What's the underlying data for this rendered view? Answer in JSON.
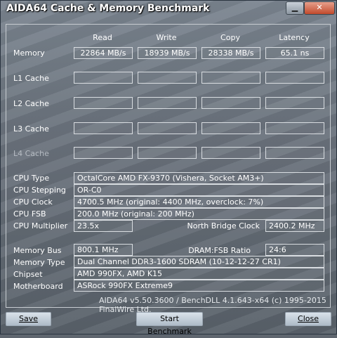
{
  "window": {
    "title": "AIDA64 Cache & Memory Benchmark",
    "minimize_glyph": "▁",
    "close_glyph": "✕"
  },
  "columns": [
    "Read",
    "Write",
    "Copy",
    "Latency"
  ],
  "rows": [
    {
      "label": "Memory",
      "values": [
        "22864 MB/s",
        "18939 MB/s",
        "28338 MB/s",
        "65.1 ns"
      ]
    },
    {
      "label": "L1 Cache",
      "values": [
        "",
        "",
        "",
        ""
      ]
    },
    {
      "label": "L2 Cache",
      "values": [
        "",
        "",
        "",
        ""
      ]
    },
    {
      "label": "L3 Cache",
      "values": [
        "",
        "",
        "",
        ""
      ]
    },
    {
      "label": "L4 Cache",
      "values": [
        "",
        "",
        "",
        ""
      ]
    }
  ],
  "info": {
    "cpu_type": {
      "label": "CPU Type",
      "value": "OctalCore AMD FX-9370  (Vishera, Socket AM3+)"
    },
    "cpu_stepping": {
      "label": "CPU Stepping",
      "value": "OR-C0"
    },
    "cpu_clock": {
      "label": "CPU Clock",
      "value": "4700.5 MHz  (original: 4400 MHz, overclock: 7%)"
    },
    "cpu_fsb": {
      "label": "CPU FSB",
      "value": "200.0 MHz  (original: 200 MHz)"
    },
    "cpu_multiplier": {
      "label": "CPU Multiplier",
      "value": "23.5x"
    },
    "north_bridge_clock": {
      "label": "North Bridge Clock",
      "value": "2400.2 MHz"
    },
    "memory_bus": {
      "label": "Memory Bus",
      "value": "800.1 MHz"
    },
    "dram_fsb_ratio": {
      "label": "DRAM:FSB Ratio",
      "value": "24:6"
    },
    "memory_type": {
      "label": "Memory Type",
      "value": "Dual Channel DDR3-1600 SDRAM  (10-12-12-27 CR1)"
    },
    "chipset": {
      "label": "Chipset",
      "value": "AMD 990FX, AMD K15"
    },
    "motherboard": {
      "label": "Motherboard",
      "value": "ASRock 990FX Extreme9"
    }
  },
  "footer": "AIDA64 v5.50.3600 / BenchDLL 4.1.643-x64  (c) 1995-2015 FinalWire Ltd.",
  "buttons": {
    "save": "Save",
    "start": "Start Benchmark",
    "close": "Close"
  }
}
